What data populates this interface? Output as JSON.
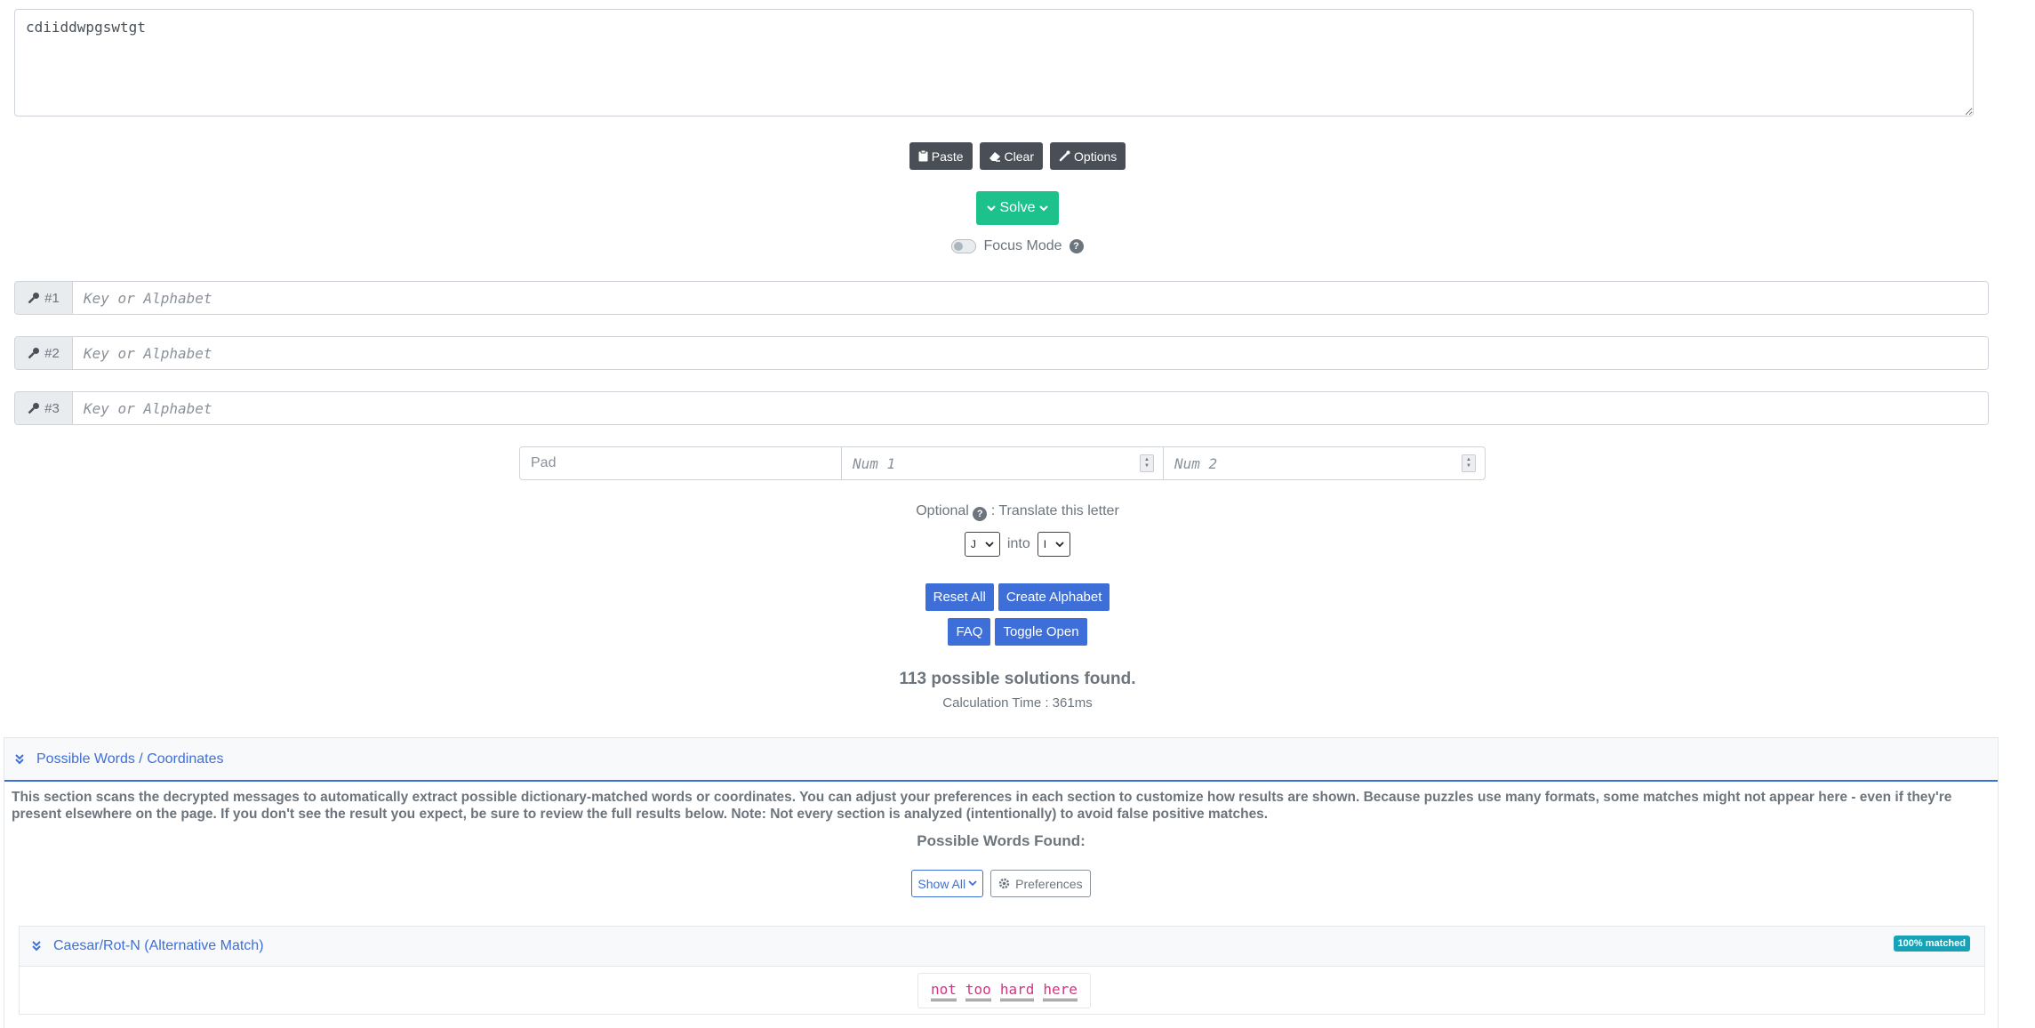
{
  "input": {
    "ciphertext": "cdiiddwpgswtgt"
  },
  "toolbar": {
    "paste_label": "Paste",
    "clear_label": "Clear",
    "options_label": "Options"
  },
  "solve": {
    "label": "Solve"
  },
  "focus_mode": {
    "label": "Focus Mode",
    "enabled": false
  },
  "keys": [
    {
      "label": "#1",
      "placeholder": "Key or Alphabet"
    },
    {
      "label": "#2",
      "placeholder": "Key or Alphabet"
    },
    {
      "label": "#3",
      "placeholder": "Key or Alphabet"
    }
  ],
  "pad": {
    "pad_placeholder": "Pad",
    "num1_placeholder": "Num 1",
    "num2_placeholder": "Num 2"
  },
  "translate": {
    "optional_label": "Optional",
    "suffix": ": Translate this letter",
    "from_value": "J",
    "into_label": "into",
    "to_value": "I"
  },
  "actions": {
    "reset_all": "Reset All",
    "create_alphabet": "Create Alphabet",
    "faq": "FAQ",
    "toggle_open": "Toggle Open"
  },
  "results": {
    "summary": "113 possible solutions found.",
    "calc_time": "Calculation Time : 361ms"
  },
  "words_panel": {
    "title": "Possible Words / Coordinates",
    "description": "This section scans the decrypted messages to automatically extract possible dictionary-matched words or coordinates. You can adjust your preferences in each section to customize how results are shown. Because puzzles use many formats, some matches might not appear here - even if they're present elsewhere on the page. If you don't see the result you expect, be sure to review the full results below. Note: Not every section is analyzed (intentionally) to avoid false positive matches.",
    "found_label": "Possible Words Found:",
    "show_all_label": "Show All",
    "preferences_label": "Preferences",
    "match": {
      "title": "Caesar/Rot-N (Alternative Match)",
      "badge": "100% matched",
      "words": [
        "not",
        "too",
        "hard",
        "here"
      ]
    }
  },
  "colors": {
    "primary": "#3e6fd8",
    "success": "#1dc18b",
    "dark": "#4a4e56",
    "word": "#d63384",
    "badge": "#17a2b8"
  }
}
